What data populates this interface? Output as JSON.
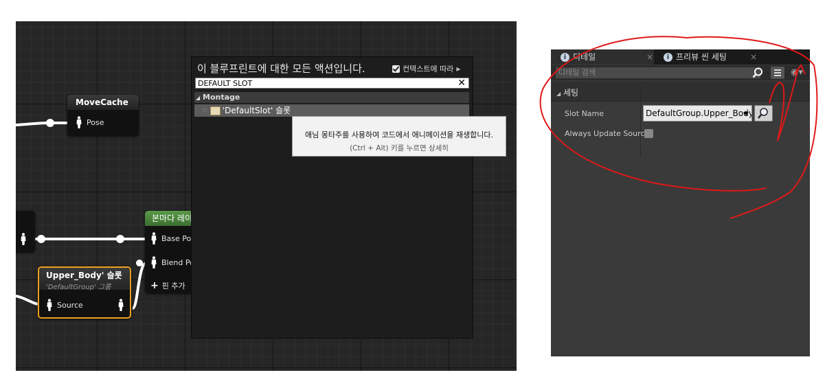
{
  "graph": {
    "nodes": {
      "move_cache": {
        "title": "MoveCache",
        "pin_pose": "Pose"
      },
      "layer_blend": {
        "title": "본마다 레이",
        "pin_base": "Base Po",
        "pin_blend": "Blend Po",
        "add_pin": "핀 추가"
      },
      "slot_node": {
        "title": "Upper_Body' 슬롯",
        "subtitle": "'DefaultGroup' 그룹",
        "pin_source": "Source"
      }
    },
    "colors": {
      "background": "#262626",
      "wire": "#ffffff",
      "layer_blend_header": "#4e8a3e",
      "selected_border": "#f0a020"
    }
  },
  "action_menu": {
    "title": "이 블루프린트에 대한 모든 액션입니다.",
    "context_label": "컨텍스트에 따라",
    "search_value": "DEFAULT SLOT",
    "category": "Montage",
    "item": "'DefaultSlot' 슬롯",
    "tooltip_main": "애님 몽타주를 사용하여 코드에서 애니메이션을 재생합니다.",
    "tooltip_sub": "(Ctrl + Alt) 키를 누르면 상세히"
  },
  "details": {
    "tabs": [
      {
        "label": "디테일"
      },
      {
        "label": "프리뷰 씬 세팅"
      }
    ],
    "search_placeholder": "디테일 검색",
    "section": "세팅",
    "props": [
      {
        "label": "Slot Name",
        "value": "DefaultGroup.Upper_Body"
      },
      {
        "label": "Always Update Source"
      }
    ],
    "annotation_color": "#e01818"
  }
}
